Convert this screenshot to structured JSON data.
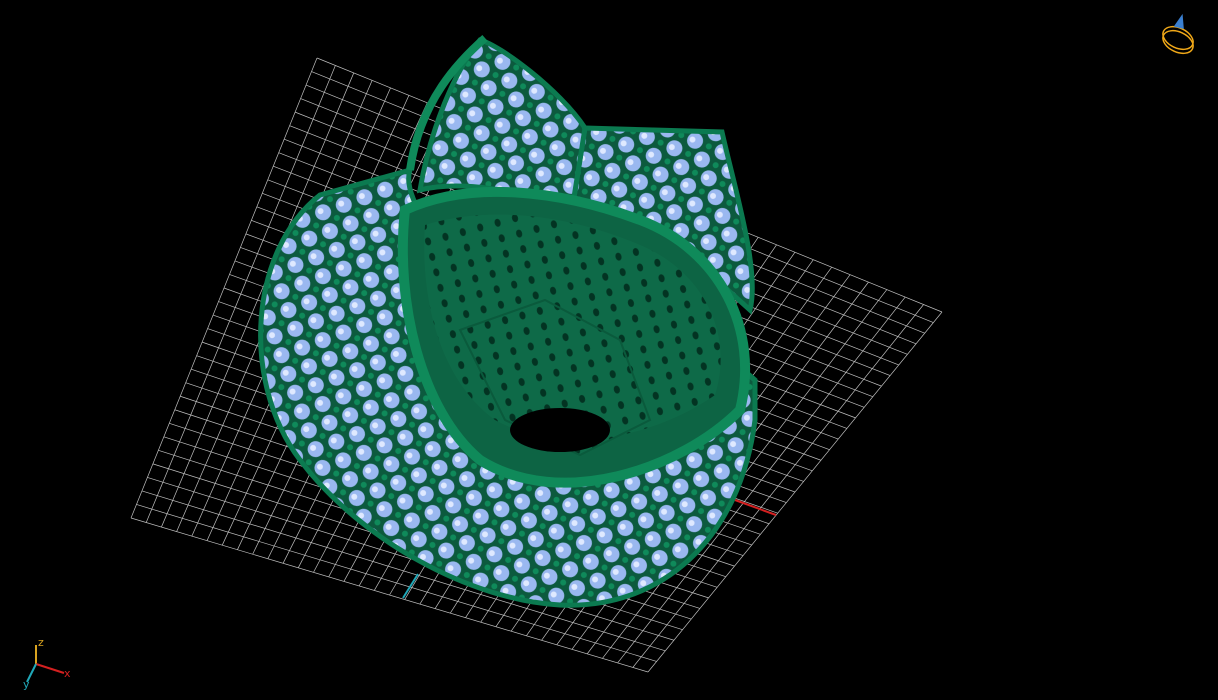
{
  "viewport": {
    "background": "#000000",
    "grid_color": "#bfbfbf",
    "model_color": "#0f6b4a",
    "gem_color": "#9ab8f0"
  },
  "axis_triad": {
    "z_label": "z",
    "x_label": "x",
    "y_label": "y",
    "z_color": "#d9a320",
    "x_color": "#d42020",
    "y_color": "#20a8b8"
  },
  "view_cube": {
    "icon": "ring-orientation-icon",
    "color": "#f0a818"
  }
}
